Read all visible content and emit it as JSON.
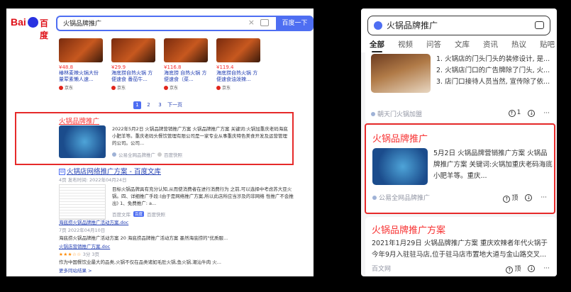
{
  "left": {
    "logo": {
      "bai": "Bai",
      "cn": "百度"
    },
    "search": {
      "query": "火锅品牌推广",
      "button": "百度一下",
      "clear": "×"
    },
    "products": [
      {
        "price": "¥48.8",
        "name": "椿林麦辣火锅大份量荤素懒人速...",
        "shop": "京东"
      },
      {
        "price": "¥29.9",
        "name": "海底捞自热火锅 方便速食 番茄牛...",
        "shop": "京东"
      },
      {
        "price": "¥116.8",
        "name": "海底捞 自热火锅 方便速食（菜...",
        "shop": "京东"
      },
      {
        "price": "¥119.4",
        "name": "海底捞自热火锅 方便速食油泼辣...",
        "shop": "京东"
      }
    ],
    "pager": {
      "p1": "1",
      "p2": "2",
      "p3": "3",
      "next": "下一页"
    },
    "result1": {
      "title": "火锅品牌推广",
      "desc": "2022年5月2日 火锅品牌营销推广方案 火锅品牌推广方案 关键词:火锅加重庆老码海底小肥羊等。重庆老码头餐饮管理有限公司是一家专业从事重庆特色美食开发及运营管理的公司。公司...",
      "source": "公易全网品牌推广",
      "snapshot": "百度快照"
    },
    "result2": {
      "icon": "W",
      "title": "火锅店网络推广方案 - 百度文库",
      "meta": "4页 发布时间: 2022年04月24日",
      "desc": "目标火锅品牌具有充分认知,从而使消费者在进行消费行为 之前,可以选择中考虑苏大亚火锅。四、详细推广手段:(由于是网络推广方案,所以此店所应当涉及的非网络 性推广不会推出) 1、免费推广: a...",
      "source": "百度文库",
      "badge": "百度",
      "snapshot": "百度快照"
    },
    "sub1": {
      "title": "海底捞火锅品牌推广活动方案.doc",
      "meta": "7页 2022年04月10日",
      "desc": "海底捞火锅品牌推广活动方案 20 海底捞品牌推广活动方案 墨然海底捞的\"优质服..."
    },
    "sub2": {
      "title": "火锅店营销推广方案.doc",
      "stars": "★★★☆☆",
      "rating": "3分 3页",
      "desc": "作为中国餐饮业最大的品类,火锅不仅在品类诸如毛肚火锅,鱼火锅,潮汕牛肉 火..."
    },
    "more": "更多同站结果 >"
  },
  "right": {
    "search": {
      "query": "火锅品牌推广"
    },
    "tabs": [
      "全部",
      "视频",
      "问答",
      "文库",
      "资讯",
      "热议",
      "贴吧"
    ],
    "card1": {
      "items": [
        "1. 火锅店的门头门头的装修设计, 是...",
        "2. 火锅店门口的广告牌除了门头, 火...",
        "3. 店门口接待人员当然, 宣传除了依..."
      ],
      "source": "朝天门火锅加盟",
      "like": "1",
      "like_icon": "↑",
      "down_icon": "↓",
      "more": "···"
    },
    "card2": {
      "title": "火锅品牌推广",
      "desc": "5月2日 火锅品牌营销推广方案 火锅品牌推广方案 关键词:火锅加重庆老码海底小肥羊等。重庆...",
      "source": "公易全网品牌推广",
      "top": "顶",
      "top_icon": "↑",
      "down_icon": "↓",
      "more": "···"
    },
    "card3": {
      "title": "火锅品牌推广方案",
      "desc": "2021年1月29日 火锅品牌推广方案 重庆欢辣者年代火锅于今年9月入驻驻马店,位于驻马店市置地大道与金山路交叉...",
      "source": "百文网",
      "top": "顶",
      "top_icon": "↑",
      "down_icon": "↓",
      "more": "···"
    }
  }
}
